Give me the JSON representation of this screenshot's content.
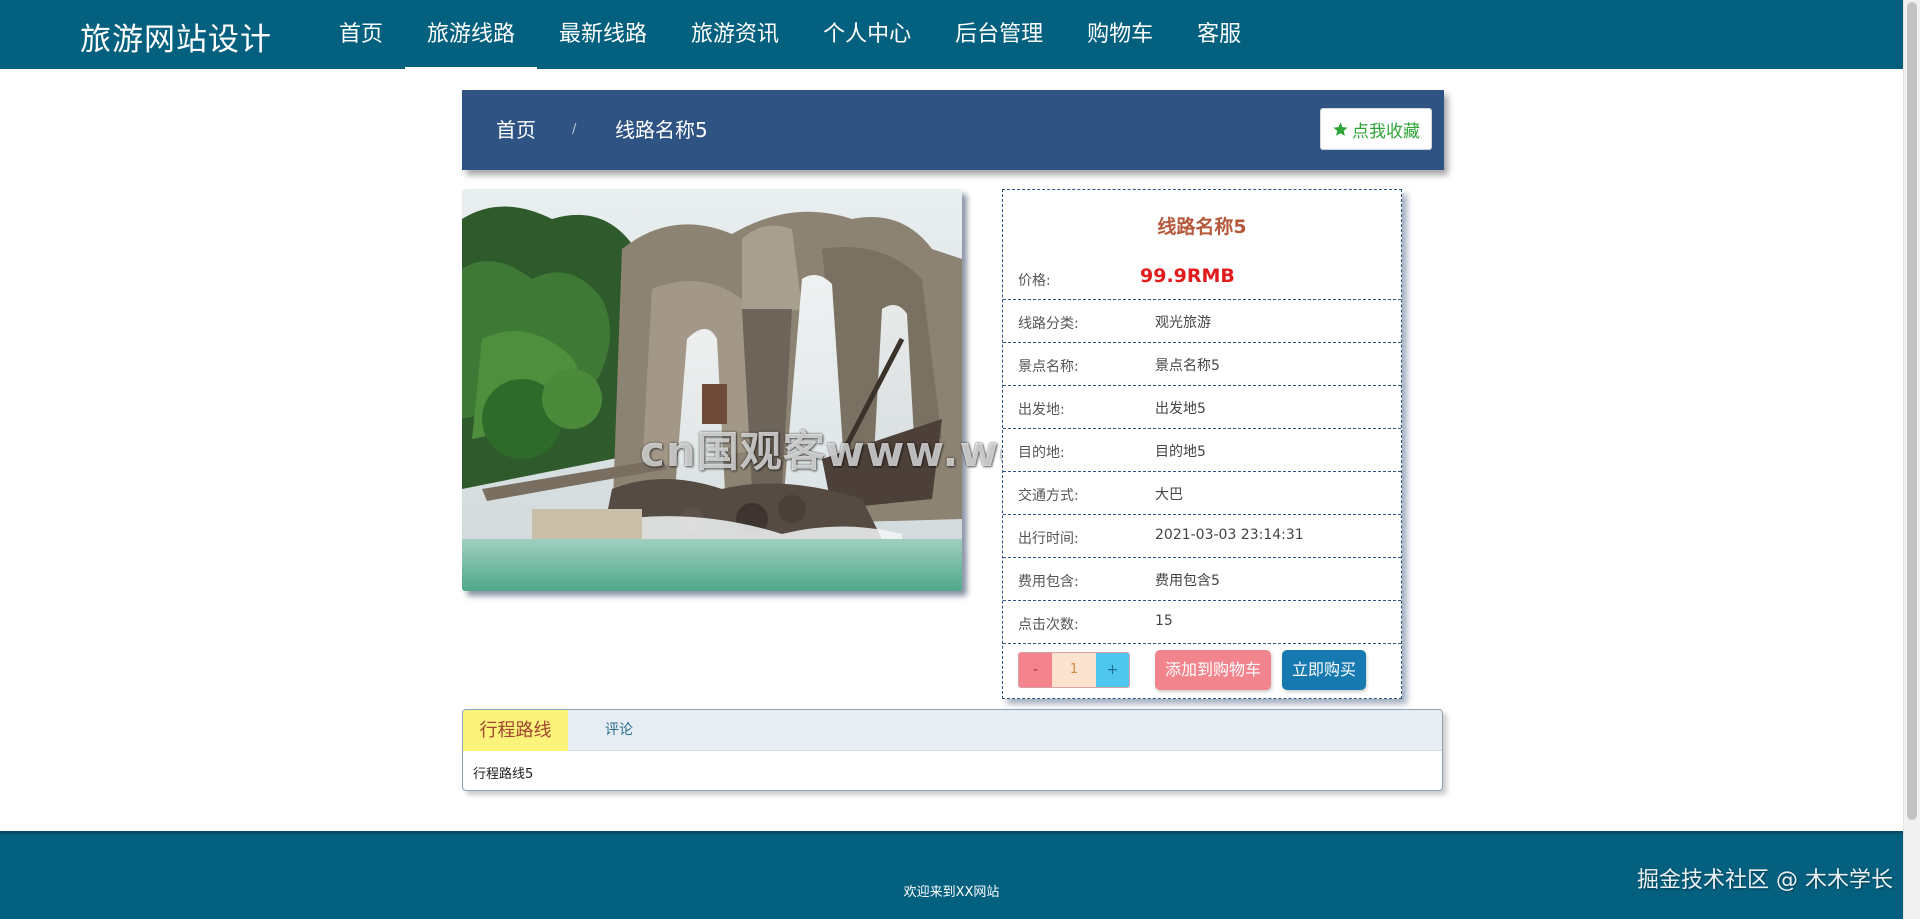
{
  "header": {
    "site_title": "旅游网站设计",
    "nav": [
      {
        "label": "首页"
      },
      {
        "label": "旅游线路"
      },
      {
        "label": "最新线路"
      },
      {
        "label": "旅游资讯"
      },
      {
        "label": "个人中心"
      },
      {
        "label": "后台管理"
      },
      {
        "label": "购物车"
      },
      {
        "label": "客服"
      }
    ],
    "active_nav": "旅游线路"
  },
  "breadcrumb": {
    "home": "首页",
    "separator": "/",
    "current": "线路名称5",
    "favorite_label": "点我收藏"
  },
  "watermark": "cn国观客www.weiguanke.cn",
  "detail": {
    "title": "线路名称5",
    "price_label": "价格:",
    "price_value": "99.9RMB",
    "rows": [
      {
        "label": "线路分类:",
        "value": "观光旅游"
      },
      {
        "label": "景点名称:",
        "value": "景点名称5"
      },
      {
        "label": "出发地:",
        "value": "出发地5"
      },
      {
        "label": "目的地:",
        "value": "目的地5"
      },
      {
        "label": "交通方式:",
        "value": "大巴"
      },
      {
        "label": "出行时间:",
        "value": "2021-03-03 23:14:31"
      },
      {
        "label": "费用包含:",
        "value": "费用包含5"
      },
      {
        "label": "点击次数:",
        "value": "15"
      }
    ],
    "stepper": {
      "minus": "-",
      "value": "1",
      "plus": "+"
    },
    "add_to_cart": "添加到购物车",
    "buy_now": "立即购买"
  },
  "tabs": {
    "items": [
      {
        "label": "行程路线"
      },
      {
        "label": "评论"
      }
    ],
    "content": "行程路线5"
  },
  "footer": {
    "text": "欢迎来到XX网站"
  },
  "corner_mark": "掘金技术社区 @ 木木学长",
  "colors": {
    "header_bg": "#04607f",
    "crumb_bg": "#2f5484",
    "price": "#e01c1c",
    "title": "#b5593a",
    "buy_button": "#1679b0",
    "cart_button": "#f1848d"
  }
}
